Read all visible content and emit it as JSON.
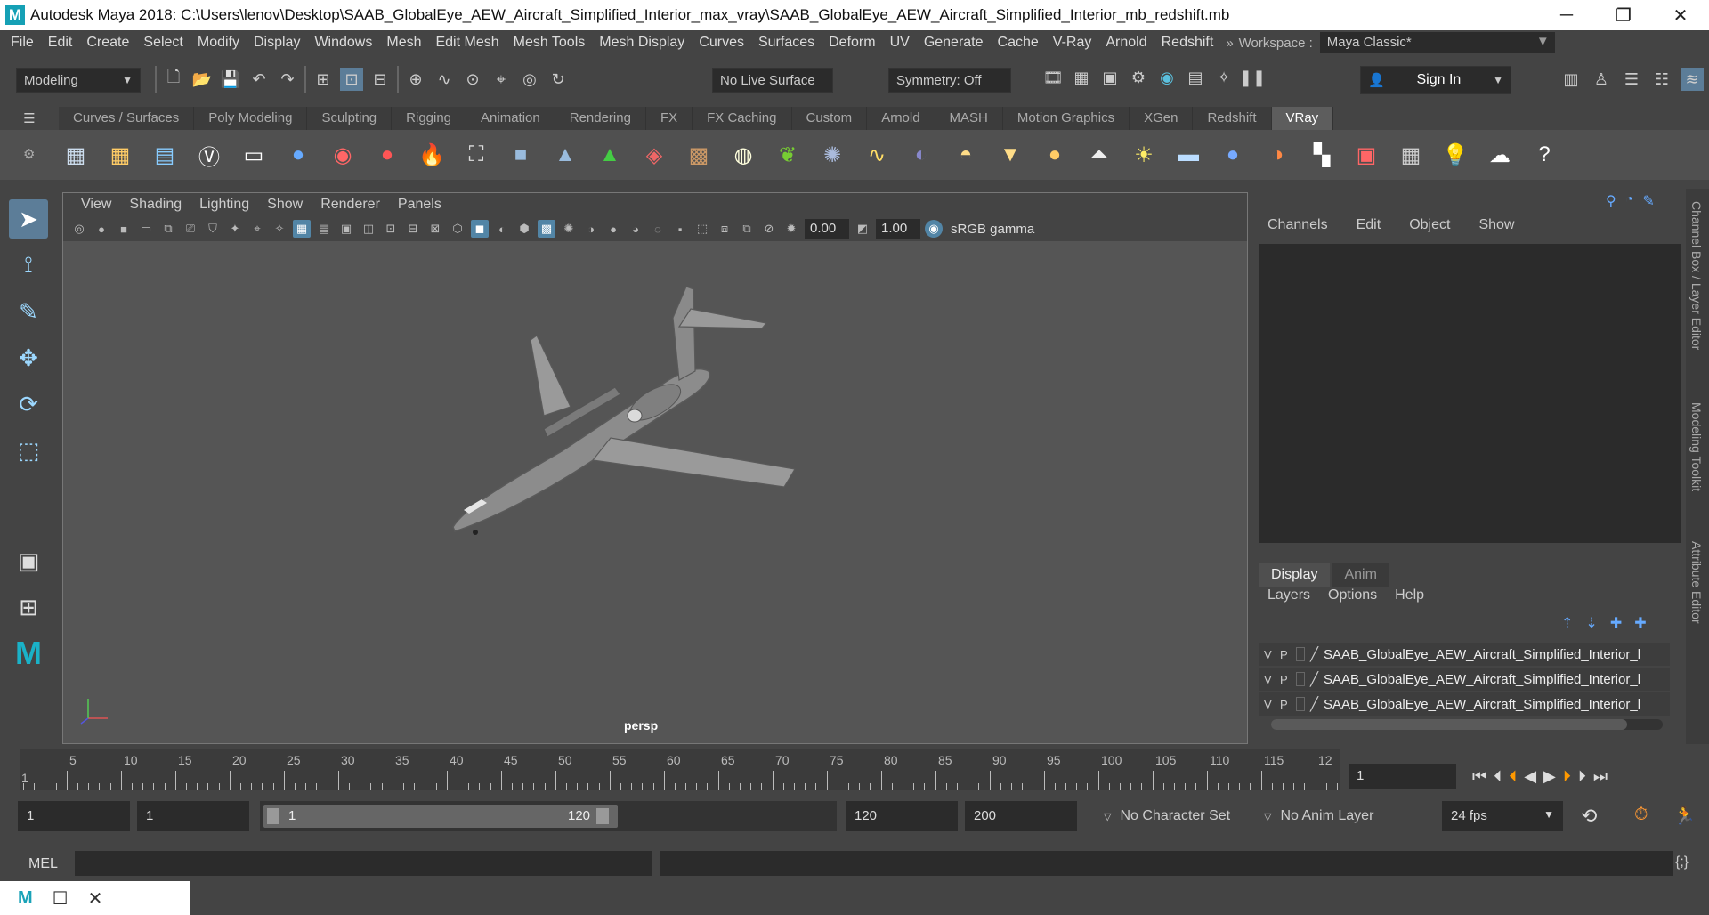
{
  "window": {
    "app_letter": "M",
    "title": "Autodesk Maya 2018: C:\\Users\\lenov\\Desktop\\SAAB_GlobalEye_AEW_Aircraft_Simplified_Interior_max_vray\\SAAB_GlobalEye_AEW_Aircraft_Simplified_Interior_mb_redshift.mb",
    "minimize": "─",
    "restore": "❐",
    "close": "✕"
  },
  "menu": [
    "File",
    "Edit",
    "Create",
    "Select",
    "Modify",
    "Display",
    "Windows",
    "Mesh",
    "Edit Mesh",
    "Mesh Tools",
    "Mesh Display",
    "Curves",
    "Surfaces",
    "Deform",
    "UV",
    "Generate",
    "Cache",
    "V-Ray",
    "Arnold",
    "Redshift"
  ],
  "workspace": {
    "label": "Workspace :",
    "value": "Maya Classic*"
  },
  "status": {
    "mode": "Modeling",
    "live_surface": "No Live Surface",
    "symmetry": "Symmetry: Off",
    "sign_in": "Sign In"
  },
  "shelf_tabs": [
    "Curves / Surfaces",
    "Poly Modeling",
    "Sculpting",
    "Rigging",
    "Animation",
    "Rendering",
    "FX",
    "FX Caching",
    "Custom",
    "Arnold",
    "MASH",
    "Motion Graphics",
    "XGen",
    "Redshift",
    "VRay"
  ],
  "active_shelf": "VRay",
  "viewport": {
    "menu": [
      "View",
      "Shading",
      "Lighting",
      "Show",
      "Renderer",
      "Panels"
    ],
    "exposure": "0.00",
    "gamma": "1.00",
    "color_space": "sRGB gamma",
    "camera": "persp"
  },
  "channel_box": {
    "menu": [
      "Channels",
      "Edit",
      "Object",
      "Show"
    ],
    "side_tabs": [
      "Channel Box / Layer Editor",
      "Modeling Toolkit",
      "Attribute Editor"
    ]
  },
  "layers": {
    "tabs": [
      "Display",
      "Anim"
    ],
    "menu": [
      "Layers",
      "Options",
      "Help"
    ],
    "rows": [
      {
        "v": "V",
        "p": "P",
        "name": "SAAB_GlobalEye_AEW_Aircraft_Simplified_Interior_l"
      },
      {
        "v": "V",
        "p": "P",
        "name": "SAAB_GlobalEye_AEW_Aircraft_Simplified_Interior_l"
      },
      {
        "v": "V",
        "p": "P",
        "name": "SAAB_GlobalEye_AEW_Aircraft_Simplified_Interior_l"
      }
    ]
  },
  "timeline": {
    "ticks": [
      "5",
      "10",
      "15",
      "20",
      "25",
      "30",
      "35",
      "40",
      "45",
      "50",
      "55",
      "60",
      "65",
      "70",
      "75",
      "80",
      "85",
      "90",
      "95",
      "100",
      "105",
      "110",
      "115",
      "12"
    ],
    "start_label": "1",
    "current_frame": "1"
  },
  "range": {
    "start": "1",
    "playback_start": "1",
    "slider_start": "1",
    "slider_end": "120",
    "playback_end": "120",
    "end": "200",
    "character_set": "No Character Set",
    "anim_layer": "No Anim Layer",
    "fps": "24 fps"
  },
  "command": {
    "lang": "MEL"
  }
}
